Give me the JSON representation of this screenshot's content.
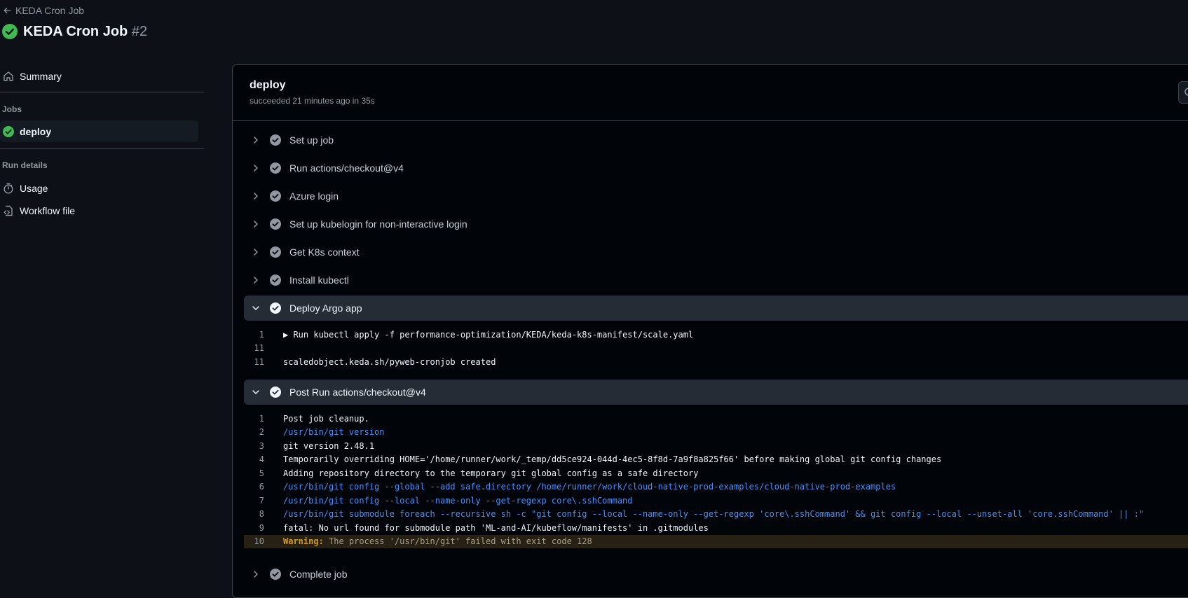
{
  "back_link": "KEDA Cron Job",
  "run": {
    "title": "KEDA Cron Job",
    "number": "#2"
  },
  "sidebar": {
    "summary": "Summary",
    "jobs_heading": "Jobs",
    "job": "deploy",
    "run_details_heading": "Run details",
    "usage": "Usage",
    "workflow_file": "Workflow file"
  },
  "job": {
    "title": "deploy",
    "meta": "succeeded 21 minutes ago in 35s"
  },
  "steps": [
    "Set up job",
    "Run actions/checkout@v4",
    "Azure login",
    "Set up kubelogin for non-interactive login",
    "Get K8s context",
    "Install kubectl",
    "Deploy Argo app",
    "Post Run actions/checkout@v4",
    "Complete job"
  ],
  "deploy_log": [
    {
      "n": "1",
      "text": "▶ Run kubectl apply -f performance-optimization/KEDA/keda-k8s-manifest/scale.yaml"
    },
    {
      "n": "11",
      "text": ""
    },
    {
      "n": "11",
      "text": "scaledobject.keda.sh/pyweb-cronjob created"
    }
  ],
  "post_log": [
    {
      "n": "1",
      "text": "Post job cleanup."
    },
    {
      "n": "2",
      "text": "/usr/bin/git version"
    },
    {
      "n": "3",
      "text": "git version 2.48.1"
    },
    {
      "n": "4",
      "text": "Temporarily overriding HOME='/home/runner/work/_temp/dd5ce924-044d-4ec5-8f8d-7a9f8a825f66' before making global git config changes"
    },
    {
      "n": "5",
      "text": "Adding repository directory to the temporary git global config as a safe directory"
    },
    {
      "n": "6",
      "text": "/usr/bin/git config --global --add safe.directory /home/runner/work/cloud-native-prod-examples/cloud-native-prod-examples"
    },
    {
      "n": "7",
      "text": "/usr/bin/git config --local --name-only --get-regexp core\\.sshCommand"
    },
    {
      "n": "8",
      "text": "/usr/bin/git submodule foreach --recursive sh -c \"git config --local --name-only --get-regexp 'core\\.sshCommand' && git config --local --unset-all 'core.sshCommand' || :\""
    },
    {
      "n": "9",
      "text": "fatal: No url found for submodule path 'ML-and-AI/kubeflow/manifests' in .gitmodules"
    },
    {
      "n": "10",
      "label": "Warning:",
      "text": " The process '/usr/bin/git' failed with exit code 128"
    }
  ],
  "colors": {
    "success": "#3fb950",
    "step_done": "#9198a1",
    "link": "#4493f8",
    "warning": "#d29922"
  }
}
